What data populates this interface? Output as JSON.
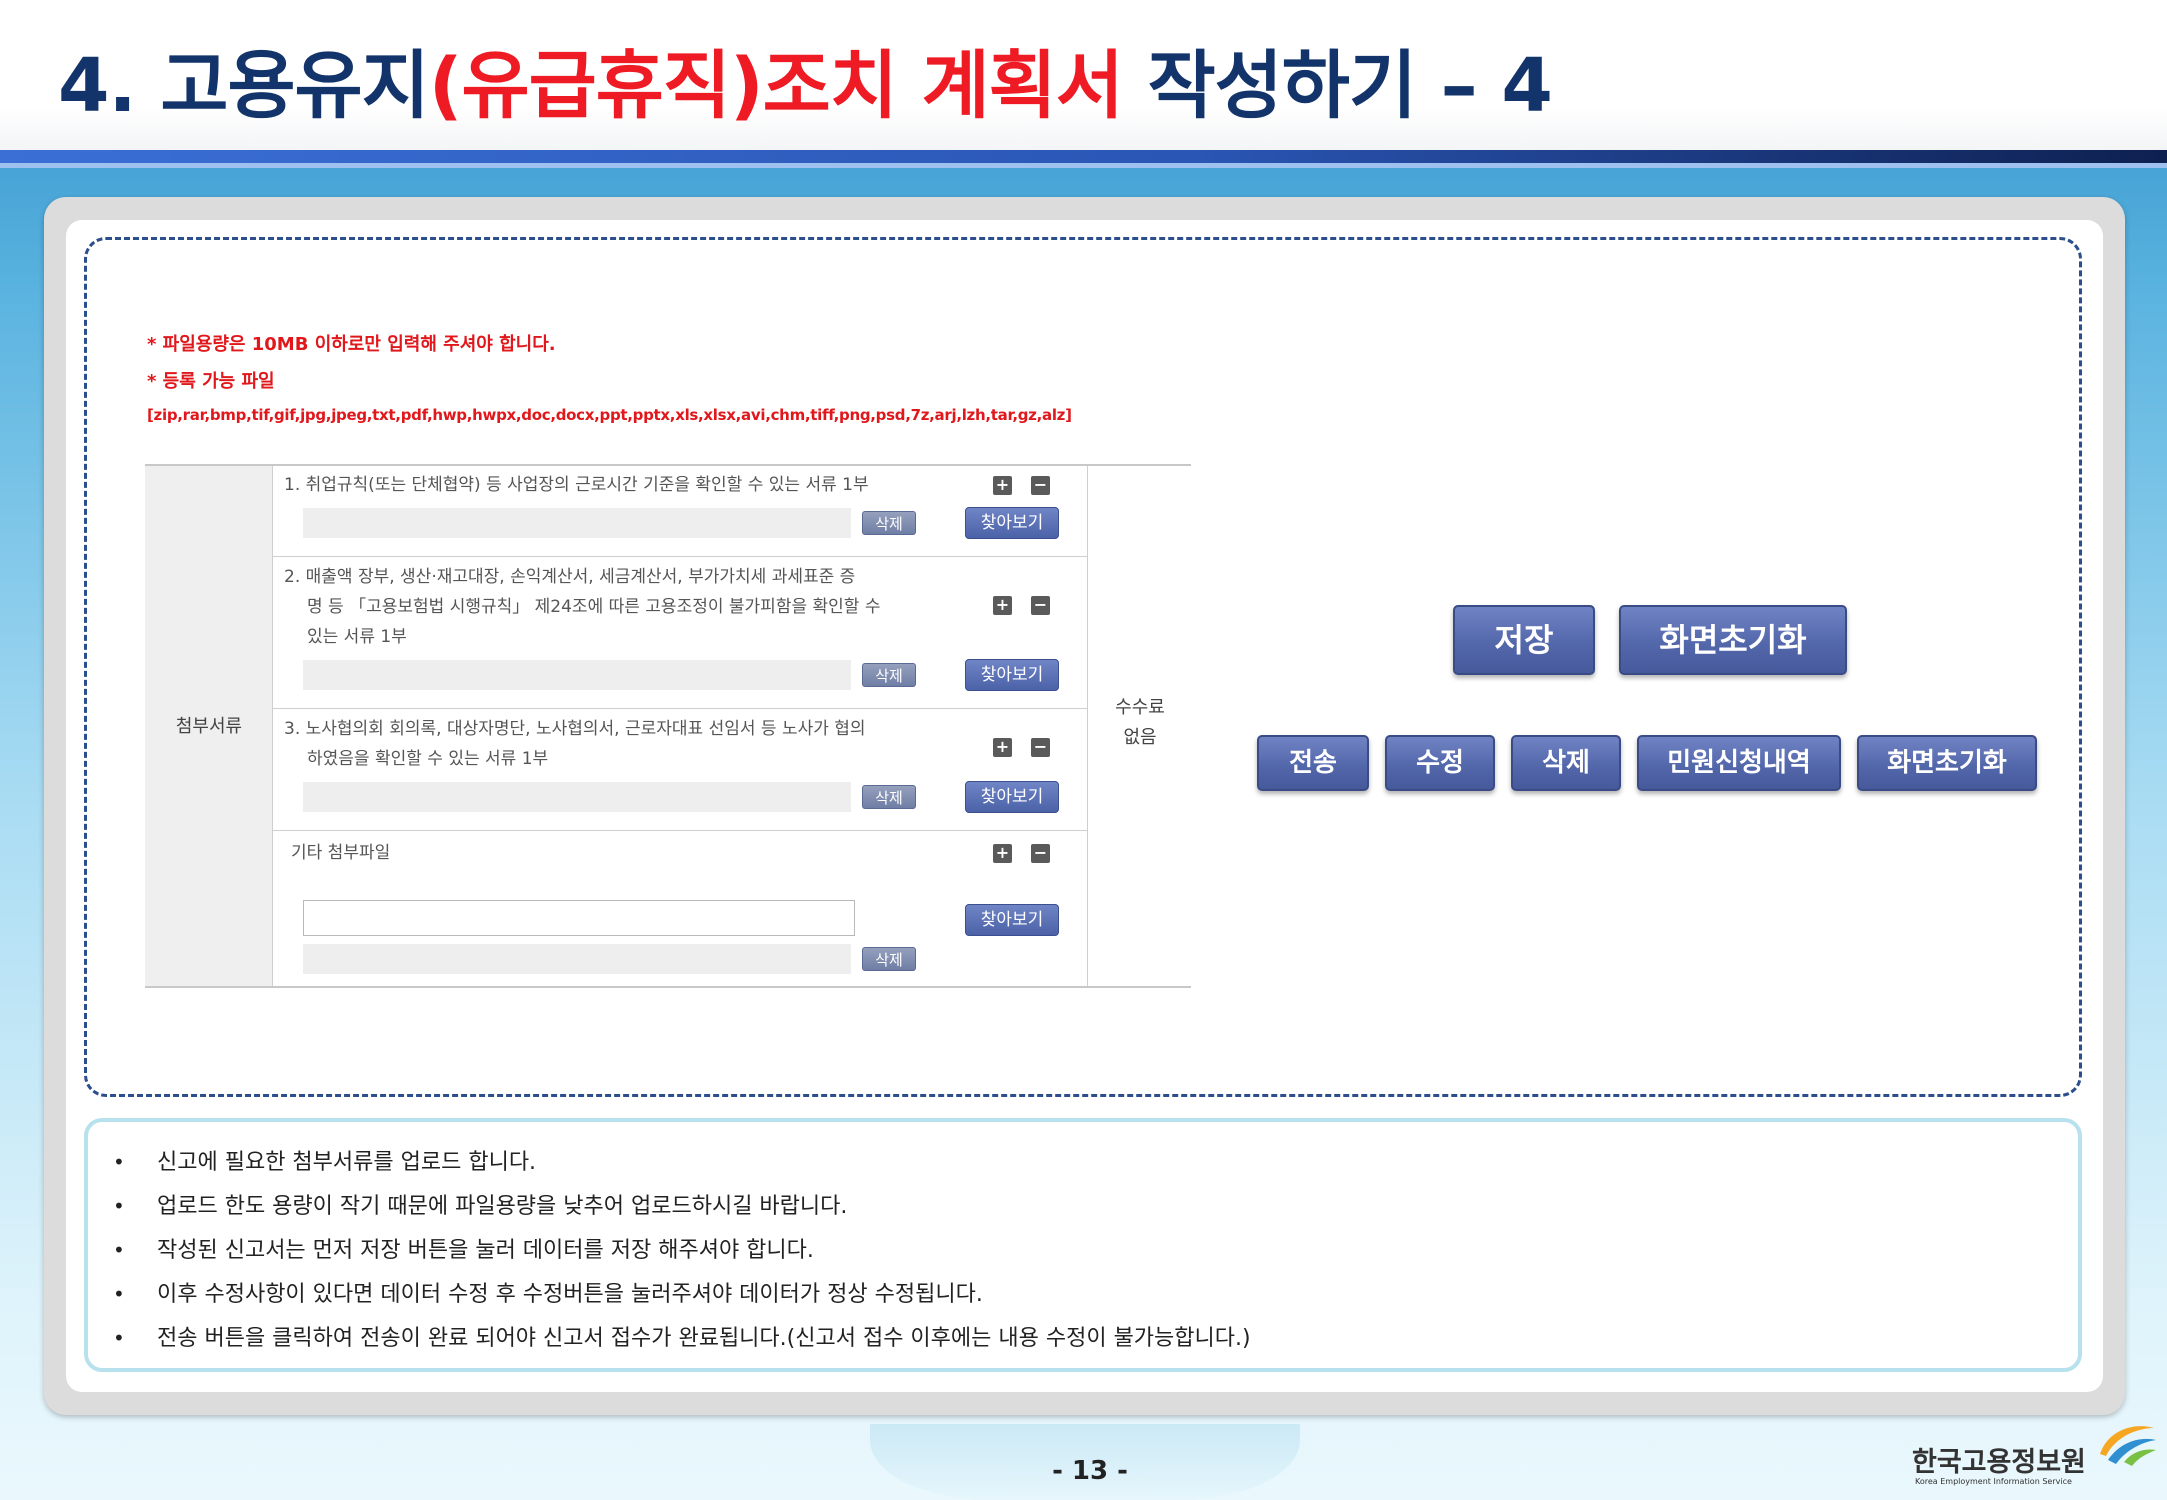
{
  "header": {
    "title_part1": "4. 고용유지",
    "title_highlight": "(유급휴직)조치 계획서",
    "title_part2": " 작성하기 – 4"
  },
  "form": {
    "notice_size": "* 파일용량은 10MB 이하로만 입력해 주셔야 합니다.",
    "notice_types_label": "* 등록 가능 파일",
    "notice_types": "[zip,rar,bmp,tif,gif,jpg,jpeg,txt,pdf,hwp,hwpx,doc,docx,ppt,pptx,xls,xlsx,avi,chm,tiff,png,psd,7z,arj,lzh,tar,gz,alz]",
    "attach_label": "첨부서류",
    "fee_line1": "수수료",
    "fee_line2": "없음",
    "docs": [
      {
        "lines": [
          "1. 취업규칙(또는 단체협약) 등 사업장의 근로시간 기준을 확인할 수 있는 서류 1부"
        ]
      },
      {
        "lines": [
          "2. 매출액 장부, 생산·재고대장, 손익계산서, 세금계산서, 부가가치세 과세표준 증",
          "명 등 「고용보험법 시행규칙」 제24조에 따른 고용조정이 불가피함을 확인할 수",
          "있는 서류 1부"
        ]
      },
      {
        "lines": [
          "3. 노사협의회 회의록, 대상자명단, 노사협의서, 근로자대표 선임서 등 노사가 협의",
          "하였음을 확인할 수 있는 서류 1부"
        ]
      },
      {
        "lines": [
          "기타 첨부파일"
        ]
      }
    ],
    "delete_label": "삭제",
    "browse_label": "찾아보기",
    "plus": "+",
    "minus": "−"
  },
  "buttons": {
    "save": "저장",
    "reset": "화면초기화",
    "send": "전송",
    "edit": "수정",
    "delete": "삭제",
    "history": "민원신청내역",
    "reset2": "화면초기화"
  },
  "info": {
    "bullet": "•",
    "items": [
      "신고에 필요한 첨부서류를 업로드 합니다.",
      "업로드 한도 용량이 작기 때문에 파일용량을 낮추어 업로드하시길 바랍니다.",
      "작성된 신고서는 먼저 저장 버튼을 눌러 데이터를 저장 해주셔야 합니다.",
      "이후 수정사항이 있다면 데이터 수정 후 수정버튼을 눌러주셔야 데이터가 정상 수정됩니다.",
      "전송 버튼을 클릭하여 전송이 완료 되어야 신고서 접수가 완료됩니다.(신고서 접수 이후에는 내용 수정이 불가능합니다.)"
    ]
  },
  "footer": {
    "page": "- 13 -",
    "org_name": "한국고용정보원",
    "org_name_en": "Korea Employment Information Service"
  }
}
